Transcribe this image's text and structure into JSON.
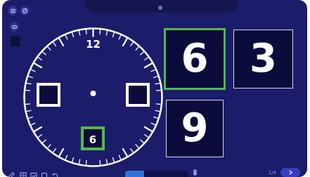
{
  "clock": {
    "twelve_label": "12",
    "answer_label": "6"
  },
  "cards": [
    {
      "value": "6",
      "selected": true
    },
    {
      "value": "3",
      "selected": false
    },
    {
      "value": "9",
      "selected": false
    }
  ],
  "footer": {
    "page_indicator": "1/4",
    "progress": 0.3
  },
  "colors": {
    "background": "#1b1d6b",
    "card": "#0b0c3c",
    "highlight": "#55b84a",
    "progress": "#2f74d6"
  },
  "icons": [
    "menu-icon",
    "hide-icon",
    "eye-icon",
    "pen-icon",
    "grid-icon",
    "image-icon",
    "shape-icon",
    "undo-icon",
    "next-arrow-icon"
  ]
}
